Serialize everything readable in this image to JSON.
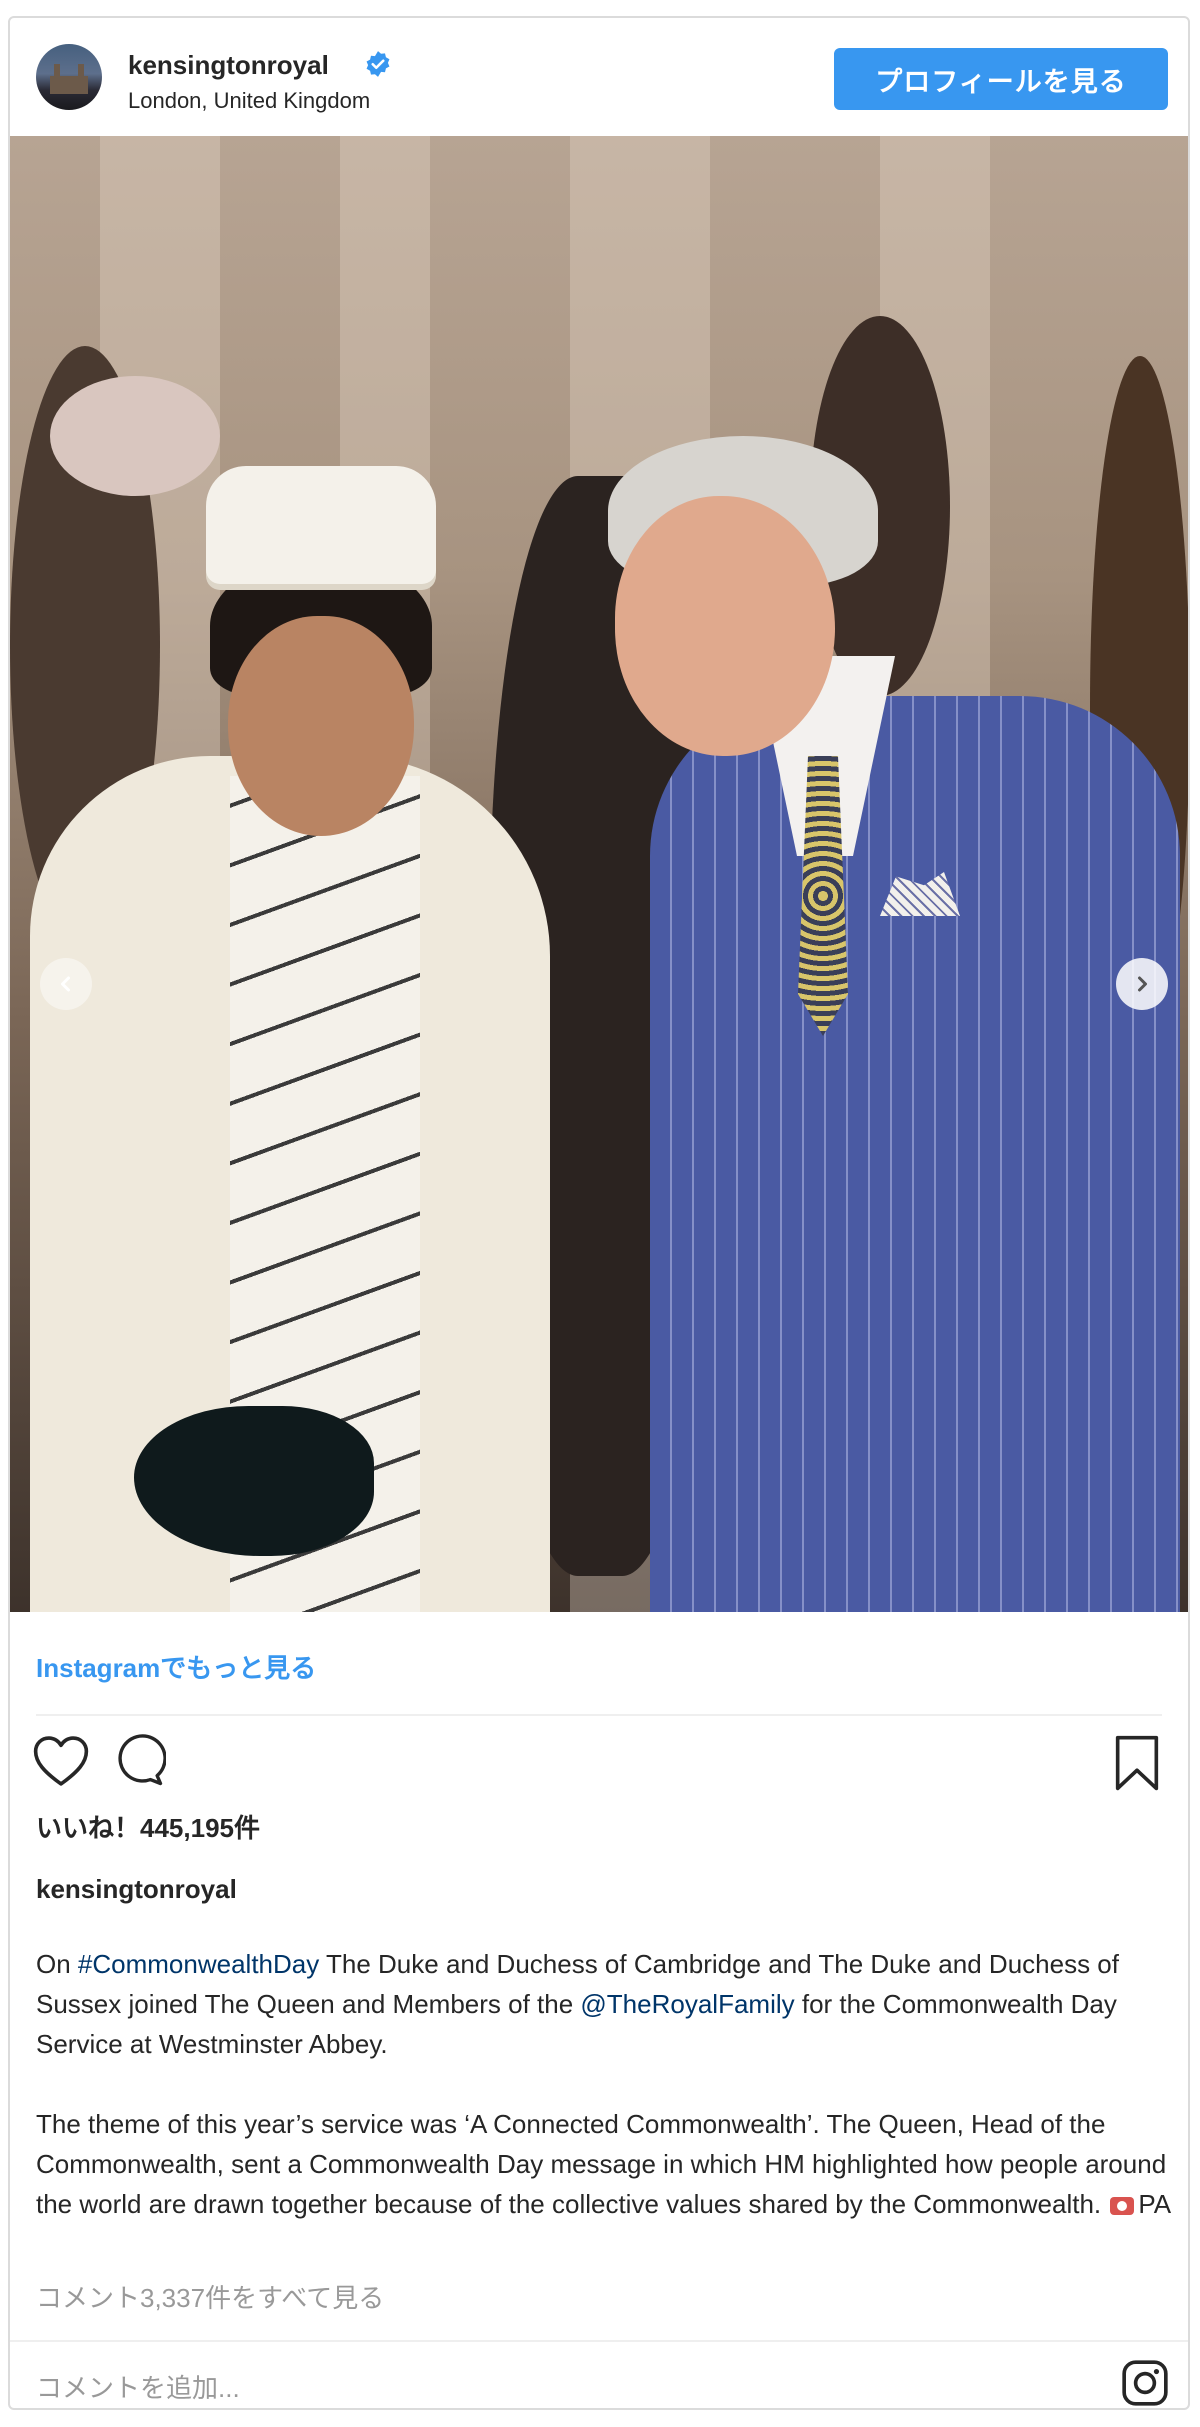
{
  "header": {
    "username": "kensingtonroyal",
    "location": "London, United Kingdom",
    "profile_button": "プロフィールを見る",
    "verified": true
  },
  "post": {
    "more_on_instagram": "Instagramでもっと見る",
    "likes": "いいね！445,195件",
    "owner": "kensingtonroyal",
    "caption": {
      "p1_prefix": "On ",
      "p1_hashtag": "#CommonwealthDay",
      "p1_middle": " The Duke and Duchess of Cambridge and The Duke and Duchess of Sussex joined The Queen and Members of the ",
      "p1_mention": "@TheRoyalFamily",
      "p1_suffix": " for the Commonwealth Day Service at Westminster Abbey.",
      "p2": "The theme of this year’s service was ‘A Connected Commonwealth’. The Queen, Head of the Commonwealth, sent a Commonwealth Day message in which HM highlighted how people around the world are drawn together because of the collective values shared by the Commonwealth. ",
      "p2_credit": "PA"
    },
    "view_all_comments": "コメント3,337件をすべて見る",
    "add_comment_placeholder": "コメントを追加..."
  },
  "colors": {
    "accent": "#3897f0",
    "link": "#003569",
    "muted": "#999999",
    "text": "#262626"
  },
  "icons": [
    "verified-badge-icon",
    "chevron-left-icon",
    "chevron-right-icon",
    "heart-icon",
    "comment-icon",
    "bookmark-icon",
    "camera-icon",
    "instagram-icon"
  ]
}
